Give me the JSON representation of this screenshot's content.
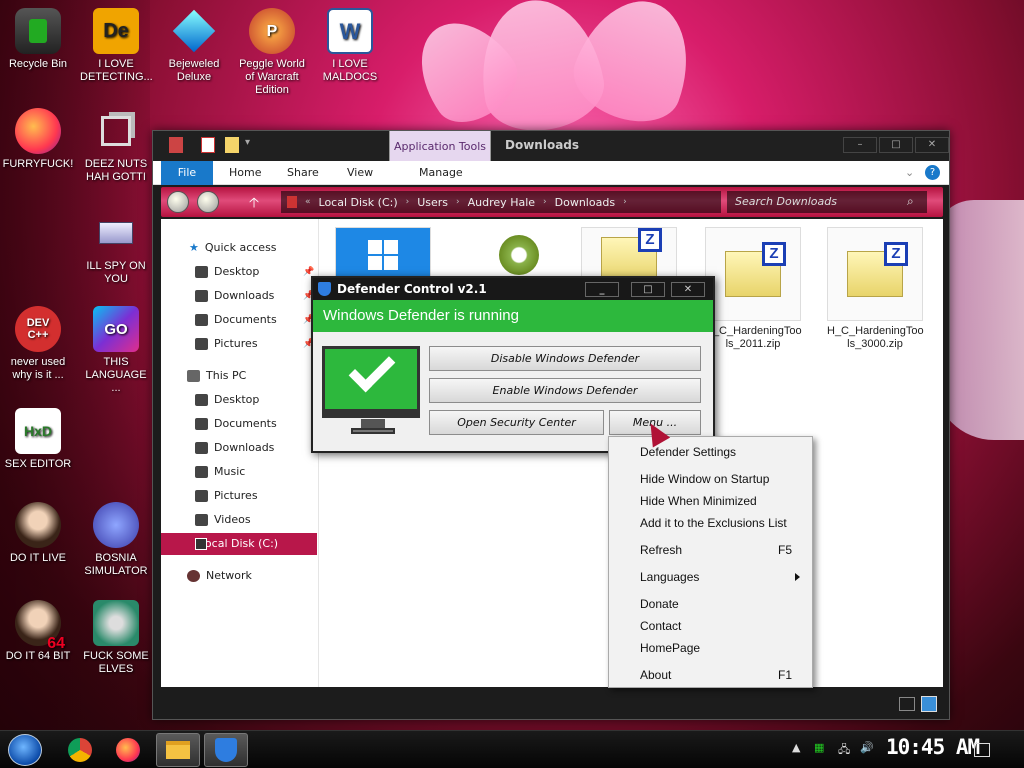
{
  "desktop": {
    "icons": [
      {
        "label": "Recycle Bin"
      },
      {
        "label": "I LOVE DETECTING..."
      },
      {
        "label": "Bejeweled Deluxe"
      },
      {
        "label": "Peggle World of Warcraft Edition"
      },
      {
        "label": "I LOVE MALDOCS"
      },
      {
        "label": "FURRYFUCK!"
      },
      {
        "label": "DEEZ NUTS HAH GOTTI"
      },
      {
        "label": "ILL SPY ON YOU"
      },
      {
        "label": "never used why is it ..."
      },
      {
        "label": "THIS LANGUAGE ..."
      },
      {
        "label": "SEX EDITOR"
      },
      {
        "label": "DO IT LIVE"
      },
      {
        "label": "BOSNIA SIMULATOR"
      },
      {
        "label": "DO IT 64 BIT"
      },
      {
        "label": "FUCK SOME ELVES"
      }
    ],
    "icon_glyphs": {
      "word": "W",
      "devcpp": "DEV C++",
      "go": "GO",
      "hxd": "HxD",
      "de": "De",
      "badge64": "64"
    }
  },
  "explorer": {
    "app_tools": "Application Tools",
    "title": "Downloads",
    "ribbon": {
      "file": "File",
      "home": "Home",
      "share": "Share",
      "view": "View",
      "manage": "Manage"
    },
    "breadcrumb": [
      "Local Disk (C:)",
      "Users",
      "Audrey Hale",
      "Downloads"
    ],
    "search_placeholder": "Search Downloads",
    "nav": {
      "quick_access": "Quick access",
      "qa_items": [
        "Desktop",
        "Downloads",
        "Documents",
        "Pictures"
      ],
      "this_pc": "This PC",
      "pc_items": [
        "Desktop",
        "Documents",
        "Downloads",
        "Music",
        "Pictures",
        "Videos"
      ],
      "local_disk": "Local Disk (C:)",
      "network": "Network"
    },
    "files": [
      {
        "name": "H_C_HardeningToo ls_2011.zip"
      },
      {
        "name": "H_C_HardeningToo ls_3000.zip"
      }
    ],
    "zip_glyph": "Z"
  },
  "defender": {
    "title": "Defender Control v2.1",
    "status": "Windows Defender is running",
    "buttons": {
      "disable": "Disable Windows Defender",
      "enable": "Enable Windows Defender",
      "security_center": "Open Security Center",
      "menu": "Menu ..."
    }
  },
  "context_menu": {
    "items": [
      {
        "label": "Defender Settings"
      },
      {
        "label": "Hide Window on Startup"
      },
      {
        "label": "Hide When Minimized"
      },
      {
        "label": "Add it to the Exclusions List"
      },
      {
        "label": "Refresh",
        "shortcut": "F5"
      },
      {
        "label": "Languages"
      },
      {
        "label": "Donate"
      },
      {
        "label": "Contact"
      },
      {
        "label": "HomePage"
      },
      {
        "label": "About",
        "shortcut": "F1"
      }
    ]
  },
  "taskbar": {
    "clock": "10:45 AM"
  },
  "colors": {
    "accent": "#b8174a",
    "status_green": "#2db83d",
    "ribbon_file": "#1979ca",
    "app_tools": "#e6d7ef"
  }
}
